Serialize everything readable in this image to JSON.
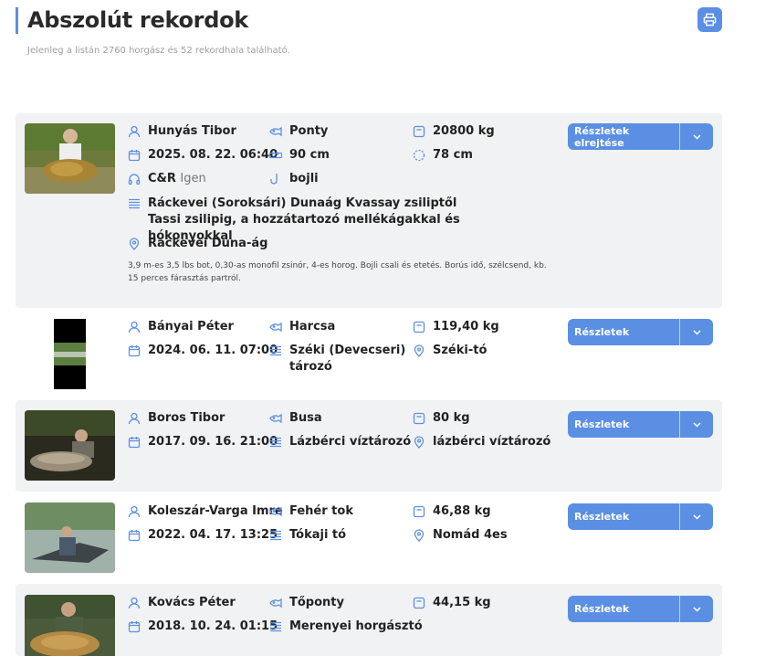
{
  "header": {
    "title": "Abszolút rekordok",
    "subtitle": "Jelenleg a listán 2760 horgász és 52 rekordhala található."
  },
  "colors": {
    "accent": "#5b8fe3",
    "card_bg": "#f1f2f3"
  },
  "icons": {
    "angler": "person-icon",
    "species": "fish-icon",
    "weight": "scale-icon",
    "date": "calendar-icon",
    "length": "ruler-icon",
    "girth": "circle-dashed-icon",
    "method": "headphones-icon",
    "bait": "hook-icon",
    "water": "waves-icon",
    "location": "pin-icon",
    "print": "printer-icon",
    "caret": "chevron-down-icon"
  },
  "records": [
    {
      "angler": "Hunyás Tibor",
      "species": "Ponty",
      "weight": "20800 kg",
      "date": "2025. 08. 22. 06:40",
      "length": "90 cm",
      "girth": "78 cm",
      "cr_label": "C&R",
      "cr_value": "Igen",
      "bait": "bojli",
      "water": "Ráckevei (Soroksári) Dunaág Kvassay zsiliptől Tassi zsilipig, a hozzátartozó mellékágakkal és hókonyokkal",
      "location": "Ráckevei Duna-ág",
      "description": "3,9 m-es 3,5 lbs bot, 0,30-as monofil zsinór, 4-es horog. Bojli csali és etetés. Borús idő, szélcsend, kb. 15 perces fárasztás partról.",
      "button": "Részletek elrejtése"
    },
    {
      "angler": "Bányai Péter",
      "species": "Harcsa",
      "weight": "119,40 kg",
      "date": "2024. 06. 11. 07:00",
      "water": "Széki (Devecseri) tározó",
      "location": "Széki-tó",
      "button": "Részletek"
    },
    {
      "angler": "Boros Tibor",
      "species": "Busa",
      "weight": "80 kg",
      "date": "2017. 09. 16. 21:00",
      "water": "Lázbérci víztározó",
      "location": "lázbérci víztározó",
      "button": "Részletek"
    },
    {
      "angler": "Koleszár-Varga Imre",
      "species": "Fehér tok",
      "weight": "46,88 kg",
      "date": "2022. 04. 17. 13:25",
      "water": "Tókaji tó",
      "location": "Nomád 4es",
      "button": "Részletek"
    },
    {
      "angler": "Kovács Péter",
      "species": "Tőponty",
      "weight": "44,15 kg",
      "date": "2018. 10. 24. 01:15",
      "water": "Merenyei horgásztó",
      "button": "Részletek"
    }
  ]
}
